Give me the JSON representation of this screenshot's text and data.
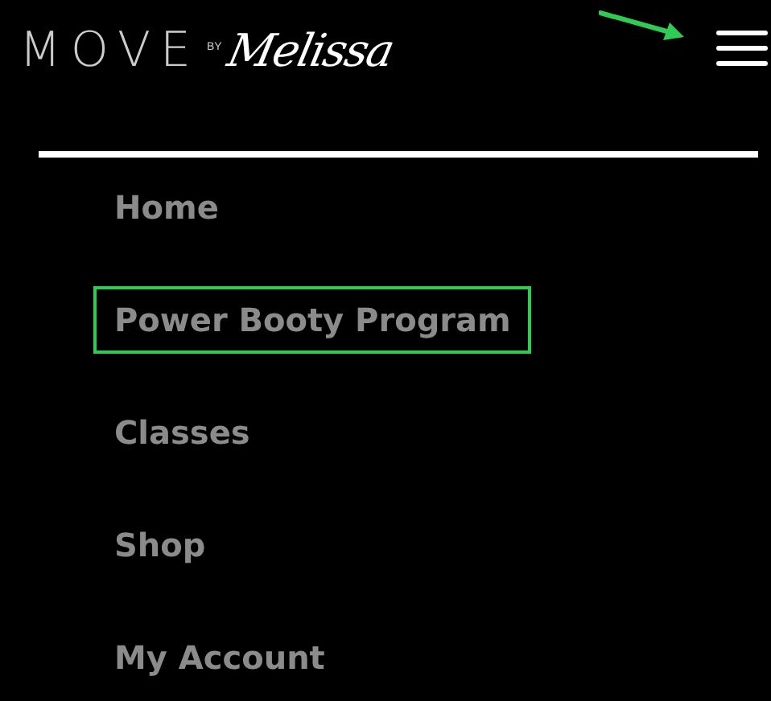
{
  "header": {
    "logo": {
      "word": "MOVE",
      "by": "BY",
      "script": "Melissa"
    },
    "menu_arrow_annotation": true
  },
  "menu": {
    "items": [
      {
        "label": "Home",
        "highlighted": false
      },
      {
        "label": "Power Booty Program",
        "highlighted": true
      },
      {
        "label": "Classes",
        "highlighted": false
      },
      {
        "label": "Shop",
        "highlighted": false
      },
      {
        "label": "My Account",
        "highlighted": false
      }
    ]
  }
}
